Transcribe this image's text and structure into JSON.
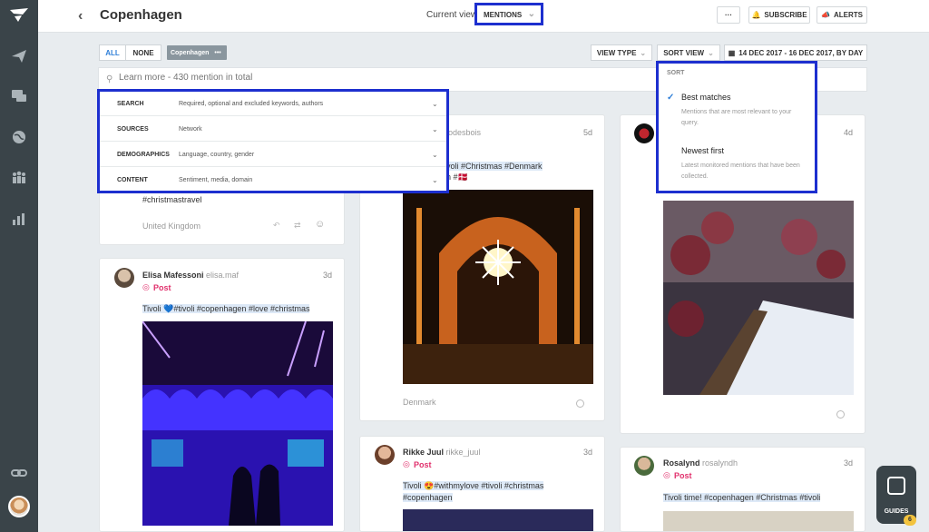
{
  "header": {
    "title": "Copenhagen",
    "view_label": "Current view",
    "view_value": "MENTIONS",
    "more_label": "···",
    "subscribe_label": "SUBSCRIBE",
    "alerts_label": "ALERTS"
  },
  "filters": {
    "all_label": "ALL",
    "none_label": "NONE",
    "chip_label": "Copenhagen",
    "chip_more": "•••",
    "view_type_label": "VIEW TYPE",
    "sort_view_label": "SORT VIEW",
    "date_range": "14 DEC 2017 - 16 DEC 2017, BY DAY"
  },
  "search": {
    "placeholder": "Learn more - 430 mention in total"
  },
  "filter_panel": {
    "rows": [
      {
        "key": "SEARCH",
        "value": "Required, optional and excluded keywords, authors"
      },
      {
        "key": "SOURCES",
        "value": "Network"
      },
      {
        "key": "DEMOGRAPHICS",
        "value": "Language, country, gender"
      },
      {
        "key": "CONTENT",
        "value": "Sentiment, media, domain"
      }
    ]
  },
  "sort_menu": {
    "header": "SORT",
    "options": [
      {
        "title": "Best matches",
        "desc": "Mentions that are most relevant to your query.",
        "selected": true
      },
      {
        "title": "Newest first",
        "desc": "Latest monitored mentions that have been collected.",
        "selected": false
      }
    ]
  },
  "cards": {
    "c1": {
      "text": "#christmastravel",
      "location": "United Kingdom"
    },
    "c2": {
      "name": "Elisa Mafessoni",
      "handle": "elisa.maf",
      "time": "3d",
      "type": "Post",
      "text": "Tivoli 💙#tivoli #copenhagen #love #christmas"
    },
    "c3": {
      "handle_partial": "lodesbois",
      "time": "5d",
      "text1": "voli #Christmas #Denmark",
      "text2": "n #🇩🇰",
      "location": "Denmark"
    },
    "c4": {
      "time": "4d"
    },
    "c5": {
      "name": "Rikke Juul",
      "handle": "rikke_juul",
      "time": "3d",
      "type": "Post",
      "text1": "Tivoli 😍#withmylove #tivoli #christmas",
      "text2": "#copenhagen"
    },
    "c6": {
      "name": "Rosalynd",
      "handle": "rosalyndh",
      "time": "3d",
      "type": "Post",
      "text": "Tivoli time! #copenhagen #Christmas #tivoli"
    }
  },
  "guides": {
    "label": "GUIDES",
    "count": "6"
  },
  "colors": {
    "highlight": "#1d2fcf",
    "sidebar": "#3a4449",
    "instagram": "#e1306c",
    "accent": "#2f7fd8"
  }
}
